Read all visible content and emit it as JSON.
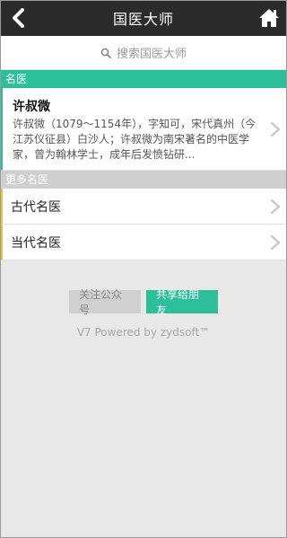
{
  "header": {
    "title": "国医大师",
    "back_icon": "back-chevron-icon",
    "home_icon": "home-icon"
  },
  "search": {
    "placeholder": "搜索国医大师",
    "icon": "search-icon"
  },
  "sections": {
    "featured_label": "名医",
    "more_label": "更多名医"
  },
  "featured": {
    "name": "许叔微",
    "description": "许叔微（1079～1154年），字知可，宋代真州（今江苏仪征县）白沙人；许叔微为南宋著名的中医学家，曾为翰林学士，成年后发愤钻研..."
  },
  "more_items": [
    {
      "label": "古代名医"
    },
    {
      "label": "当代名医"
    }
  ],
  "actions": {
    "follow_label": "关注公众号",
    "share_label": "共享给朋友"
  },
  "footer": {
    "powered": "V7 Powered by zydsoft™"
  },
  "colors": {
    "header_bg": "#2b2b2b",
    "accent_green": "#2bbf9a",
    "accent_yellow": "#e8c43a"
  }
}
